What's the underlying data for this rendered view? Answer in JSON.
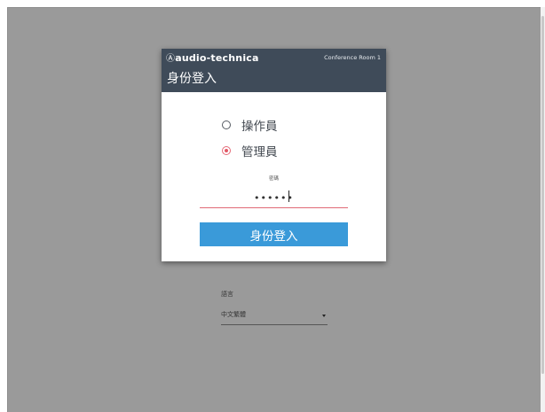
{
  "header": {
    "brand": "audio-technica",
    "brand_mark": "Ⓐ",
    "room": "Conference Room 1",
    "title": "身份登入"
  },
  "roles": [
    {
      "label": "操作員",
      "selected": false
    },
    {
      "label": "管理員",
      "selected": true
    }
  ],
  "password": {
    "label": "密碼",
    "value": "••••••"
  },
  "login_button": "身份登入",
  "language": {
    "label": "語言",
    "selected": "中文繁體"
  },
  "colors": {
    "header_bg": "#3f4b59",
    "accent_button": "#3a9ad9",
    "radio_selected": "#e25866",
    "backdrop": "#9a9a9a"
  }
}
